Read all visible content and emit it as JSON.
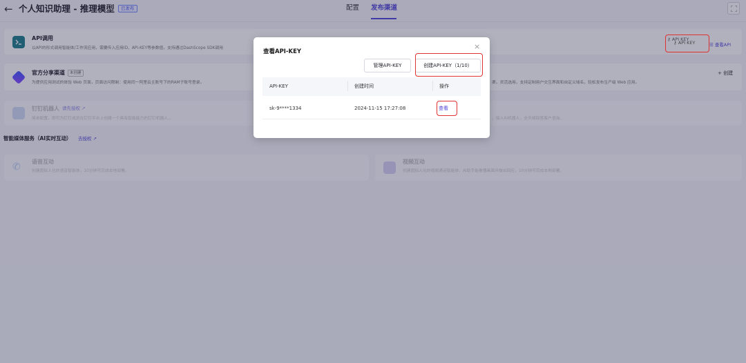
{
  "header": {
    "back_icon": "←",
    "title": "个人知识助理 - 推理模型",
    "status_badge": "已发布",
    "tabs": [
      {
        "label": "配置",
        "active": false
      },
      {
        "label": "发布渠道",
        "active": true
      }
    ]
  },
  "channels": {
    "api": {
      "title": "API调用",
      "description": "以API的形式调用智能体/工作流应用，需要传入应用ID、API-KEY等参数值，支持通过DashScope SDK调用",
      "api_key_button": "API KEY",
      "view_api_link": "查看API"
    },
    "official_share": {
      "title": "官方分享渠道",
      "tag": "未创建",
      "description": "为提供应用测试的体验 Web 页面，页面访问限制：使用同一阿里云主账号下的RAM子账号登录。",
      "description_right": "渠，灵活选用，支持定制用户交互界面和自定义域名，轻松发布生产级 Web 应用。",
      "create_button": "+ 创建"
    },
    "dingtalk": {
      "title": "钉钉机器人",
      "auth_link": "请先授权 ↗",
      "description": "简单配置，即可为钉钉成员在钉钉平台上创建一个具有智能能力的钉钉机器人...",
      "description_right": "，接入AI机器人，全天候回答客户咨询。"
    }
  },
  "media_section": {
    "title": "智能媒体服务（AI实时互动）",
    "auth_link": "去授权 ↗",
    "voice": {
      "title": "语音互动",
      "description": "创建超拟人化的语音智能体，10分钟可完成本地部署。"
    },
    "video": {
      "title": "视频互动",
      "description": "创建超拟人化的视频通话智能体，AI助手能看懂画面并做出回应，10分钟可完成本地部署。"
    }
  },
  "modal": {
    "title": "查看API-KEY",
    "close_icon": "×",
    "manage_button": "管理API-KEY",
    "create_button": "创建API-KEY（1/10）",
    "columns": [
      "API-KEY",
      "创建时间",
      "操作"
    ],
    "rows": [
      {
        "api_key": "sk-9****1334",
        "created": "2024-11-15 17:27:08",
        "action": "查看"
      }
    ]
  },
  "colors": {
    "accent": "#5145d6",
    "highlight": "#e03030",
    "overlay": "rgba(40,40,75,0.36)"
  }
}
